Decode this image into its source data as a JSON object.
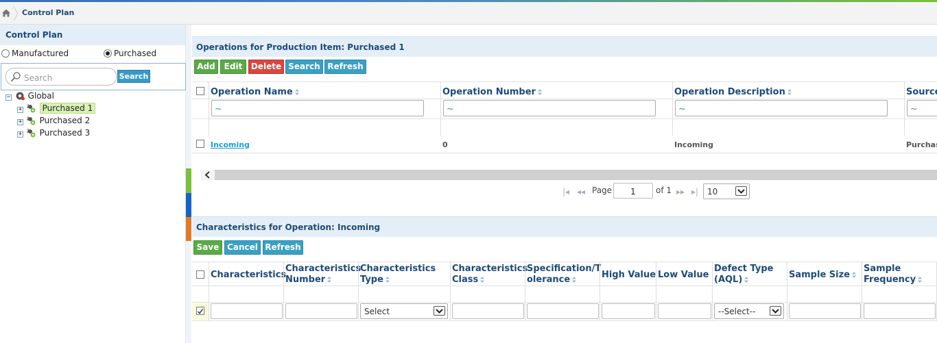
{
  "breadcrumb": {
    "title": "Control Plan"
  },
  "left": {
    "title": "Control Plan",
    "radios": [
      {
        "label": "Manufactured",
        "checked": false
      },
      {
        "label": "Purchased",
        "checked": true
      }
    ],
    "search": {
      "placeholder": "Search",
      "button": "Search"
    },
    "tree": {
      "root": "Global",
      "items": [
        "Purchased 1",
        "Purchased 2",
        "Purchased 3"
      ],
      "selected": "Purchased 1"
    }
  },
  "operations": {
    "title": "Operations for Production Item: Purchased 1",
    "buttons": {
      "add": "Add",
      "edit": "Edit",
      "delete": "Delete",
      "search": "Search",
      "refresh": "Refresh"
    },
    "columns": [
      "Operation Name",
      "Operation Number",
      "Operation Description",
      "Source"
    ],
    "filter_symbol": "~",
    "rows": [
      {
        "name": "Incoming",
        "number": "0",
        "description": "Incoming",
        "source": "Purchase"
      }
    ],
    "pager": {
      "page_label": "Page",
      "page": "1",
      "of_label": "of 1",
      "page_size": "10"
    }
  },
  "characteristics": {
    "title": "Characteristics for Operation: Incoming",
    "buttons": {
      "save": "Save",
      "cancel": "Cancel",
      "refresh": "Refresh"
    },
    "columns": [
      "Characteristics",
      "Characteristics Number",
      "Characteristics Type",
      "Characteristics Class",
      "Specification/Tolerance",
      "High Value",
      "Low Value",
      "Defect Type (AQL)",
      "Sample Size",
      "Sample Frequency"
    ],
    "column_display": {
      "spec": [
        "Specification/T",
        "olerance"
      ],
      "defect": [
        "Defect Type",
        "(AQL)"
      ]
    },
    "edit_row": {
      "checked": true,
      "type_select": "Select",
      "defect_select": "--Select--"
    }
  },
  "colors": {
    "accent": "#1d4a78",
    "green": "#5aaa47",
    "red": "#d9473f",
    "blue": "#3aa0c4",
    "band_green": "#7bbf3a",
    "band_blue": "#1565c0",
    "band_orange": "#e07a2c"
  }
}
